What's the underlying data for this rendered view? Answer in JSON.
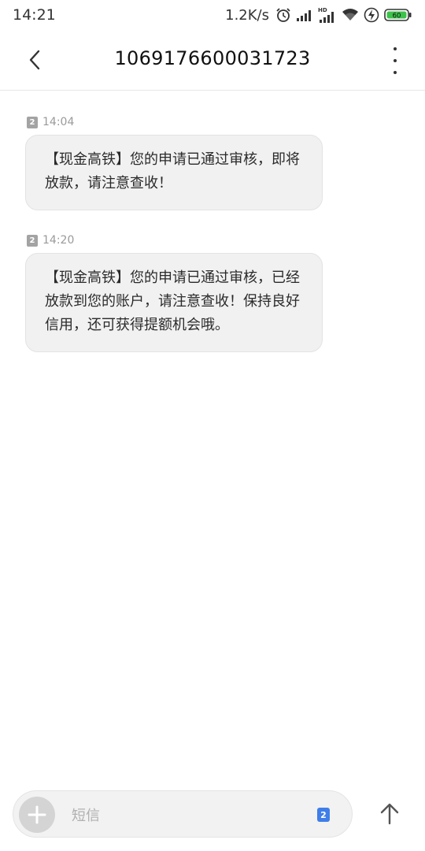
{
  "status_bar": {
    "time": "14:21",
    "net_speed": "1.2K/s",
    "battery_level": "60",
    "icons": [
      "alarm-icon",
      "signal-icon",
      "hd-signal-icon",
      "wifi-icon",
      "charging-icon",
      "battery-icon"
    ]
  },
  "header": {
    "title": "1069176600031723",
    "back_icon": "chevron-left-icon",
    "more_icon": "more-vertical-icon"
  },
  "messages": [
    {
      "sim": "2",
      "time": "14:04",
      "text": "【现金高铁】您的申请已通过审核，即将放款，请注意查收！"
    },
    {
      "sim": "2",
      "time": "14:20",
      "text": "【现金高铁】您的申请已通过审核，已经放款到您的账户，请注意查收！保持良好信用，还可获得提额机会哦。"
    }
  ],
  "composer": {
    "placeholder": "短信",
    "sim": "2",
    "add_icon": "plus-icon",
    "send_icon": "arrow-up-icon"
  },
  "colors": {
    "bubble_bg": "#f1f1f1",
    "sim_select": "#3f7ee8",
    "battery_green": "#3cc24a"
  }
}
